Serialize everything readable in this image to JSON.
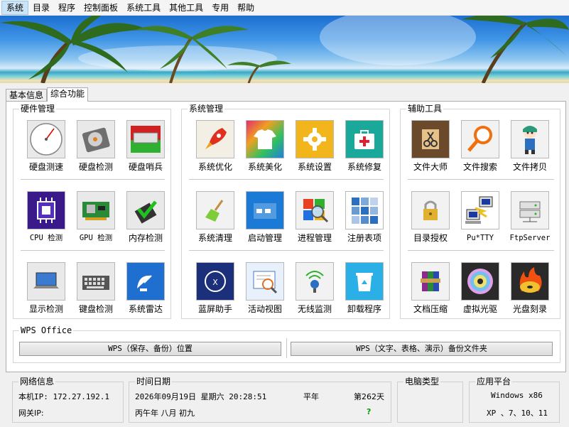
{
  "menu": [
    "系统",
    "目录",
    "程序",
    "控制面板",
    "系统工具",
    "其他工具",
    "专用",
    "帮助"
  ],
  "tabs": [
    "基本信息",
    "综合功能"
  ],
  "hardware": {
    "title": "硬件管理",
    "items": [
      {
        "label": "硬盘测速",
        "icon": "gauge-icon"
      },
      {
        "label": "硬盘检测",
        "icon": "hard-disk-icon"
      },
      {
        "label": "硬盘哨兵",
        "icon": "drive-sentinel-icon"
      },
      {
        "label": "CPU 检测",
        "icon": "cpu-icon"
      },
      {
        "label": "GPU 检测",
        "icon": "gpu-card-icon"
      },
      {
        "label": "内存检测",
        "icon": "memory-check-icon"
      },
      {
        "label": "显示检测",
        "icon": "laptop-display-icon"
      },
      {
        "label": "键盘检测",
        "icon": "keyboard-icon"
      },
      {
        "label": "系统雷达",
        "icon": "satellite-dish-icon"
      }
    ]
  },
  "system": {
    "title": "系统管理",
    "items": [
      {
        "label": "系统优化",
        "icon": "rocket-icon"
      },
      {
        "label": "系统美化",
        "icon": "tshirt-icon"
      },
      {
        "label": "系统设置",
        "icon": "gear-icon"
      },
      {
        "label": "系统修复",
        "icon": "first-aid-kit-icon"
      },
      {
        "label": "系统清理",
        "icon": "broom-icon"
      },
      {
        "label": "启动管理",
        "icon": "startup-window-icon"
      },
      {
        "label": "进程管理",
        "icon": "windows-magnifier-icon"
      },
      {
        "label": "注册表项",
        "icon": "registry-tiles-icon"
      },
      {
        "label": "蓝屏助手",
        "icon": "bluescreen-icon"
      },
      {
        "label": "活动视图",
        "icon": "activity-view-icon"
      },
      {
        "label": "无线监测",
        "icon": "wireless-icon"
      },
      {
        "label": "卸载程序",
        "icon": "recycle-bin-icon"
      }
    ]
  },
  "tools": {
    "title": "辅助工具",
    "items": [
      {
        "label": "文件大师",
        "icon": "scissors-folder-icon"
      },
      {
        "label": "文件搜索",
        "icon": "magnifier-icon"
      },
      {
        "label": "文件拷贝",
        "icon": "mascot-icon"
      },
      {
        "label": "目录授权",
        "icon": "padlock-icon"
      },
      {
        "label": "Pu*TTY",
        "icon": "putty-icon"
      },
      {
        "label": "FtpServer",
        "icon": "ftp-server-icon"
      },
      {
        "label": "文档压缩",
        "icon": "archive-books-icon"
      },
      {
        "label": "虚拟光驱",
        "icon": "virtual-disc-icon"
      },
      {
        "label": "光盘刻录",
        "icon": "burning-disc-icon"
      }
    ]
  },
  "wps": {
    "title": "WPS Office",
    "btn_location": "WPS（保存、备份）位置",
    "btn_backup": "WPS（文字、表格、演示）备份文件夹"
  },
  "network": {
    "title": "网络信息",
    "local_ip": "本机IP: 172.27.192.1",
    "gateway": "网关IP:"
  },
  "datetime": {
    "title": "时间日期",
    "datetime": "2026年09月19日  星期六  20:28:51",
    "year_type": "平年",
    "day_of_year": "第262天",
    "lunar": "丙午年   八月   初九",
    "unknown_mark": "?"
  },
  "computer_type": {
    "title": "电脑类型"
  },
  "platform": {
    "title": "应用平台",
    "line1": "Windows x86",
    "line2": "XP 、7、10、11"
  },
  "colors": {
    "accent_green": "#00a000",
    "menu_highlight": "#cce4f7"
  }
}
